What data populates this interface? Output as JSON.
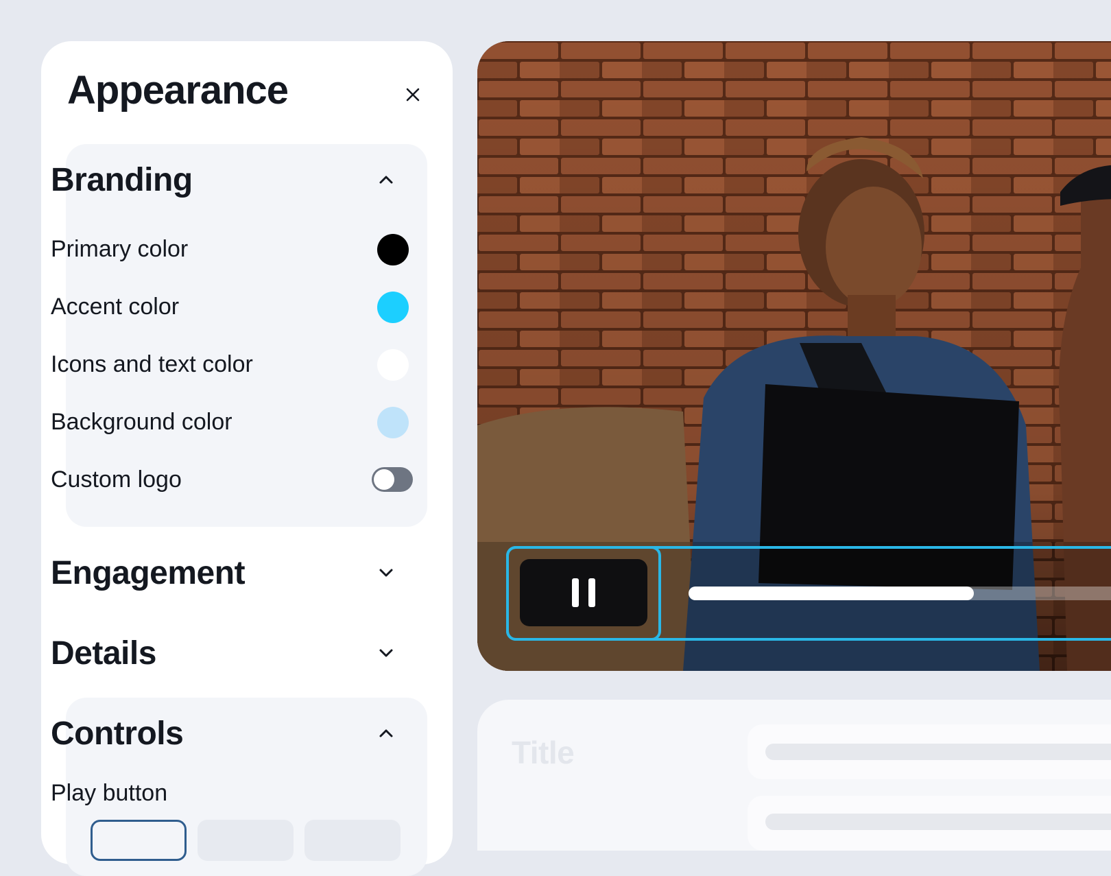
{
  "panel": {
    "title": "Appearance",
    "close_icon": "close-icon"
  },
  "sections": {
    "branding": {
      "label": "Branding",
      "expanded": true,
      "chevron_icon": "chevron-up-icon",
      "rows": [
        {
          "label": "Primary color",
          "type": "swatch",
          "color": "#000000"
        },
        {
          "label": "Accent color",
          "type": "swatch",
          "color": "#1ccfff"
        },
        {
          "label": "Icons and text color",
          "type": "swatch",
          "color": "#ffffff"
        },
        {
          "label": "Background color",
          "type": "swatch",
          "color": "#bfe3fa"
        },
        {
          "label": "Custom logo",
          "type": "toggle",
          "on": false
        }
      ]
    },
    "engagement": {
      "label": "Engagement",
      "expanded": false,
      "chevron_icon": "chevron-down-icon"
    },
    "details": {
      "label": "Details",
      "expanded": false,
      "chevron_icon": "chevron-down-icon"
    },
    "controls": {
      "label": "Controls",
      "expanded": true,
      "chevron_icon": "chevron-up-icon",
      "play_button_label": "Play button",
      "play_button_options": 3,
      "selected_option": 0
    }
  },
  "player": {
    "pause_icon": "pause-icon",
    "progress": 0.65,
    "accent": "#2ab7e6"
  },
  "details_card": {
    "title": "Title"
  }
}
